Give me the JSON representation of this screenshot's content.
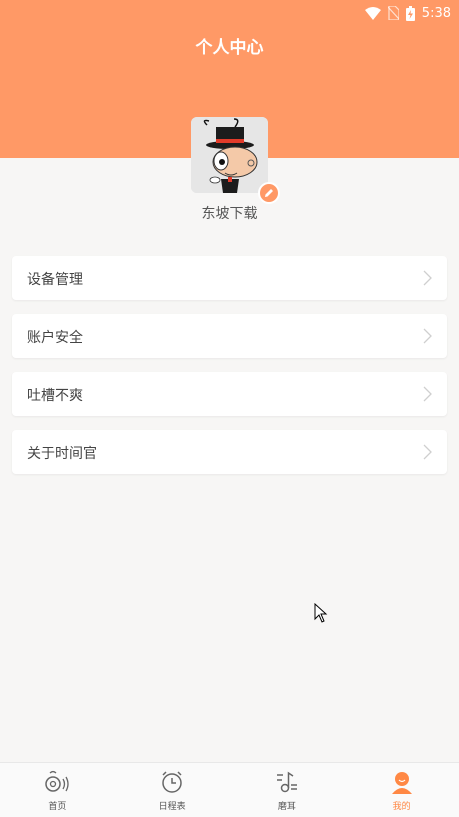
{
  "status_bar": {
    "time": "5:38"
  },
  "header": {
    "title": "个人中心"
  },
  "profile": {
    "username": "东坡下载"
  },
  "menu": [
    {
      "label": "设备管理"
    },
    {
      "label": "账户安全"
    },
    {
      "label": "吐槽不爽"
    },
    {
      "label": "关于时间官"
    }
  ],
  "tabbar": [
    {
      "label": "首页",
      "icon": "home-listen-icon",
      "active": false
    },
    {
      "label": "日程表",
      "icon": "alarm-clock-icon",
      "active": false
    },
    {
      "label": "磨耳",
      "icon": "music-note-icon",
      "active": false
    },
    {
      "label": "我的",
      "icon": "person-icon",
      "active": true
    }
  ],
  "colors": {
    "accent": "#ff9966",
    "active_tab": "#ff8844",
    "background": "#f7f6f5"
  }
}
